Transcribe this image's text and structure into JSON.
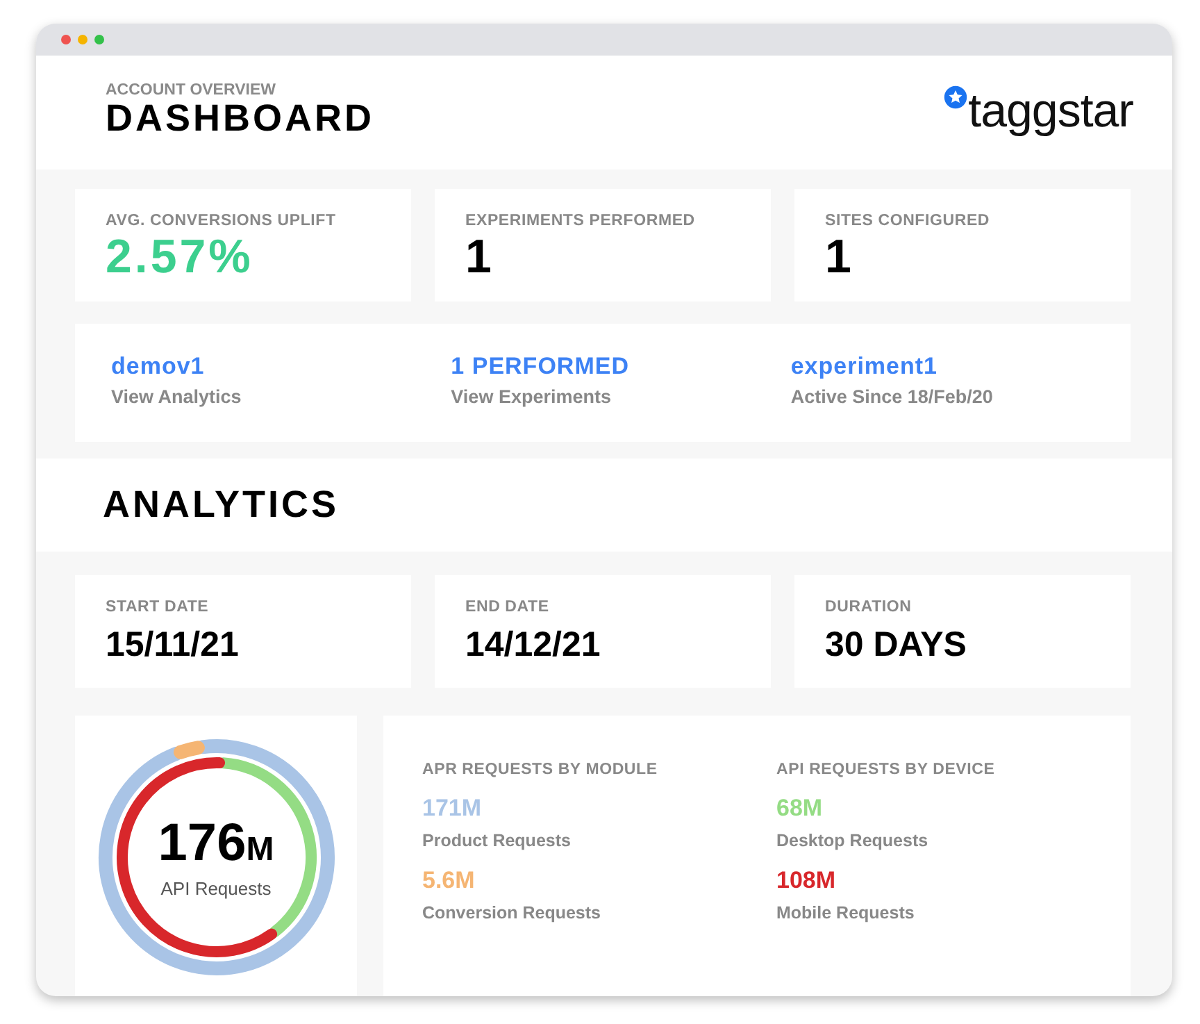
{
  "header": {
    "eyebrow": "ACCOUNT OVERVIEW",
    "title": "DASHBOARD",
    "logo": "taggstar"
  },
  "stats": [
    {
      "label": "AVG. CONVERSIONS UPLIFT",
      "value": "2.57%",
      "kind": "highlight"
    },
    {
      "label": "EXPERIMENTS PERFORMED",
      "value": "1",
      "kind": "plain"
    },
    {
      "label": "SITES CONFIGURED",
      "value": "1",
      "kind": "plain"
    }
  ],
  "links": [
    {
      "title": "demov1",
      "subtitle": "View Analytics"
    },
    {
      "title": "1 PERFORMED",
      "subtitle": "View Experiments"
    },
    {
      "title": "experiment1",
      "subtitle": "Active Since 18/Feb/20"
    }
  ],
  "analytics_title": "ANALYTICS",
  "dates": [
    {
      "label": "START DATE",
      "value": "15/11/21"
    },
    {
      "label": "END DATE",
      "value": "14/12/21"
    },
    {
      "label": "DURATION",
      "value": "30 DAYS"
    }
  ],
  "total": {
    "value": "176",
    "unit": "M",
    "caption": "API Requests"
  },
  "groups": [
    {
      "title": "APR REQUESTS BY MODULE",
      "metrics": [
        {
          "value": "171M",
          "label": "Product Requests",
          "color": "#a9c4e6"
        },
        {
          "value": "5.6M",
          "label": "Conversion Requests",
          "color": "#f5b573"
        }
      ]
    },
    {
      "title": "API REQUESTS BY DEVICE",
      "metrics": [
        {
          "value": "68M",
          "label": "Desktop Requests",
          "color": "#94dc84"
        },
        {
          "value": "108M",
          "label": "Mobile Requests",
          "color": "#d8272b"
        }
      ]
    }
  ]
}
